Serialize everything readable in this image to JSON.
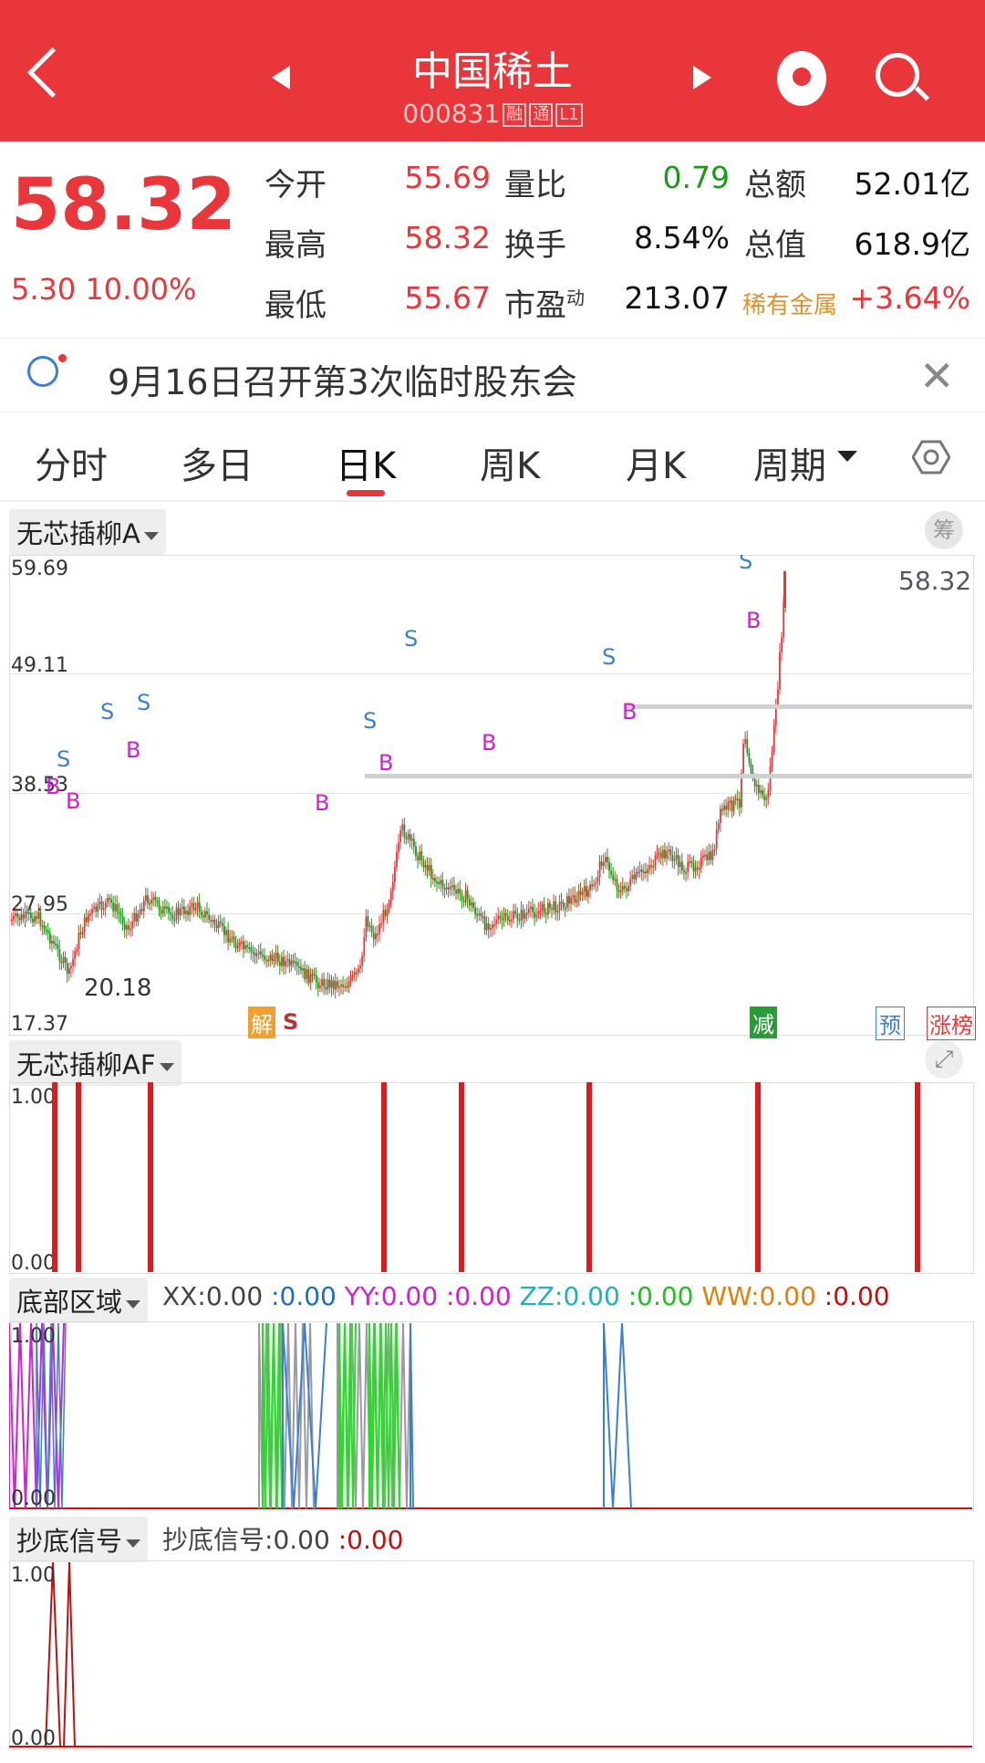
{
  "header": {
    "title": "中国稀土",
    "code": "000831",
    "tags": [
      "融",
      "通",
      "L1"
    ]
  },
  "quote": {
    "price": "58.32",
    "change": "5.30",
    "change_pct": "10.00%",
    "rows": [
      {
        "l1": "今开",
        "v1": "55.69",
        "l2": "量比",
        "v2": "0.79",
        "l3": "总额",
        "v3": "52.01亿"
      },
      {
        "l1": "最高",
        "v1": "58.32",
        "l2": "换手",
        "v2": "8.54%",
        "l3": "总值",
        "v3": "618.9亿"
      },
      {
        "l1": "最低",
        "v1": "55.67",
        "l2": "市盈",
        "l2sup": "动",
        "v2": "213.07",
        "l3": "稀有金属",
        "v3": "+3.64%"
      }
    ]
  },
  "notice": {
    "text": "9月16日召开第3次临时股东会"
  },
  "tabs": [
    "分时",
    "多日",
    "日K",
    "周K",
    "月K",
    "周期"
  ],
  "main_chart": {
    "indicator": "无芯插柳A",
    "chip_btn": "筹",
    "y_labels": [
      "59.69",
      "49.11",
      "38.53",
      "27.95",
      "17.37"
    ],
    "last_price": "58.32",
    "low_label": "20.18",
    "markers": {
      "jie": "解",
      "s": "S",
      "jian": "减",
      "yu": "预",
      "zhang": "涨榜"
    },
    "signal_s": "S",
    "signal_b": "B"
  },
  "af_panel": {
    "indicator": "无芯插柳AF",
    "y_top": "1.00",
    "y_bottom": "0.00"
  },
  "bottom_panel": {
    "indicator": "底部区域",
    "y_top": "1.00",
    "y_bottom": "0.00",
    "legend": [
      {
        "k": "XX",
        "v": "0.00",
        "v2": "0.00",
        "c1": "#444444",
        "c2": "#1a6fc4"
      },
      {
        "k": "YY",
        "v": "0.00",
        "v2": "0.00",
        "c1": "#d020d0",
        "c2": "#d020d0"
      },
      {
        "k": "ZZ",
        "v": "0.00",
        "v2": "0.00",
        "c1": "#20b0c0",
        "c2": "#20c020"
      },
      {
        "k": "WW",
        "v": "0.00",
        "v2": "0.00",
        "c1": "#e08010",
        "c2": "#c01010"
      }
    ]
  },
  "signal_panel": {
    "indicator": "抄底信号",
    "label": "抄底信号",
    "v": "0.00",
    "v2": "0.00",
    "y_top": "1.00",
    "y_bottom": "0.00"
  },
  "colors": {
    "up": "#e8363a",
    "down": "#1a9a1a",
    "brand": "#e8363a"
  },
  "icons": [
    "back-icon",
    "prev-icon",
    "next-icon",
    "mascot-icon",
    "search-icon",
    "bulb-icon",
    "close-icon",
    "settings-icon",
    "expand-icon"
  ]
}
